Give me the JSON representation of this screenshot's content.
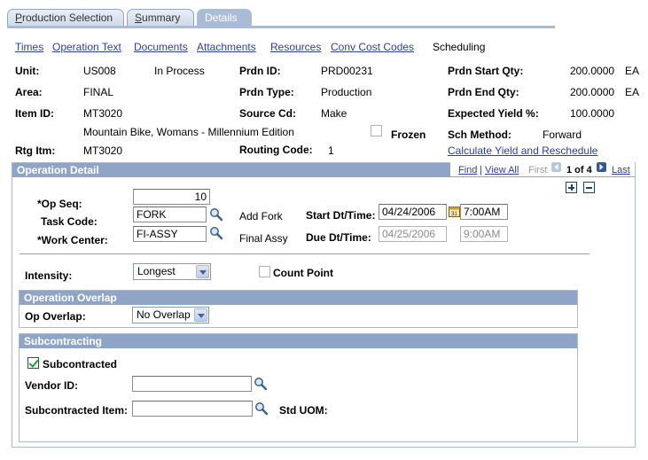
{
  "tabs": [
    {
      "label": "Production Selection",
      "accel": "P",
      "rest": "roduction Selection",
      "active": false
    },
    {
      "label": "Summary",
      "accel": "S",
      "rest": "ummary",
      "active": false
    },
    {
      "label": "Details",
      "accel": "",
      "rest": "Details",
      "active": true
    }
  ],
  "links": {
    "times": "Times",
    "operation_text": "Operation Text",
    "documents": "Documents",
    "attachments": "Attachments",
    "resources": "Resources",
    "conv_cost_codes": "Conv Cost Codes",
    "scheduling": "Scheduling"
  },
  "header": {
    "unit_label": "Unit:",
    "unit_value": "US008",
    "status": "In Process",
    "area_label": "Area:",
    "area_value": "FINAL",
    "item_id_label": "Item ID:",
    "item_id_value": "MT3020",
    "item_desc": "Mountain Bike, Womans - Millennium Edition",
    "rtg_itm_label": "Rtg Itm:",
    "rtg_itm_value": "MT3020",
    "prdn_id_label": "Prdn ID:",
    "prdn_id_value": "PRD00231",
    "prdn_type_label": "Prdn Type:",
    "prdn_type_value": "Production",
    "source_cd_label": "Source Cd:",
    "source_cd_value": "Make",
    "frozen_label": "Frozen",
    "frozen_checked": false,
    "routing_code_label": "Routing Code:",
    "routing_code_value": "1",
    "start_qty_label": "Prdn Start Qty:",
    "start_qty_value": "200.0000",
    "start_qty_uom": "EA",
    "end_qty_label": "Prdn End Qty:",
    "end_qty_value": "200.0000",
    "end_qty_uom": "EA",
    "yield_label": "Expected Yield %:",
    "yield_value": "100.0000",
    "sch_method_label": "Sch Method:",
    "sch_method_value": "Forward",
    "calc_link": "Calculate Yield and Reschedule"
  },
  "operation_detail": {
    "title": "Operation Detail",
    "nav": {
      "find": "Find",
      "view_all": "View All",
      "first": "First",
      "counter": "1 of 4",
      "last": "Last"
    },
    "op_seq_label": "*Op Seq:",
    "op_seq_value": "10",
    "task_code_label": "Task Code:",
    "task_code_value": "FORK",
    "task_code_desc": "Add Fork",
    "work_center_label": "*Work Center:",
    "work_center_value": "FI-ASSY",
    "work_center_desc": "Final Assy",
    "start_label": "Start Dt/Time:",
    "start_date": "04/24/2006",
    "start_time": "7:00AM",
    "due_label": "Due Dt/Time:",
    "due_date": "04/25/2006",
    "due_time": "9:00AM",
    "intensity_label": "Intensity:",
    "intensity_value": "Longest",
    "count_point_label": "Count Point",
    "count_point_checked": false
  },
  "operation_overlap": {
    "title": "Operation Overlap",
    "op_overlap_label": "Op Overlap:",
    "op_overlap_value": "No Overlap"
  },
  "subcontracting": {
    "title": "Subcontracting",
    "subcontracted_label": "Subcontracted",
    "subcontracted_checked": true,
    "vendor_id_label": "Vendor ID:",
    "vendor_id_value": "",
    "sub_item_label": "Subcontracted Item:",
    "sub_item_value": "",
    "std_uom_label": "Std UOM:"
  },
  "colors": {
    "link": "#2a3fa8",
    "group_header": "#8fa5c7",
    "tab_active": "#a9bcd7"
  }
}
